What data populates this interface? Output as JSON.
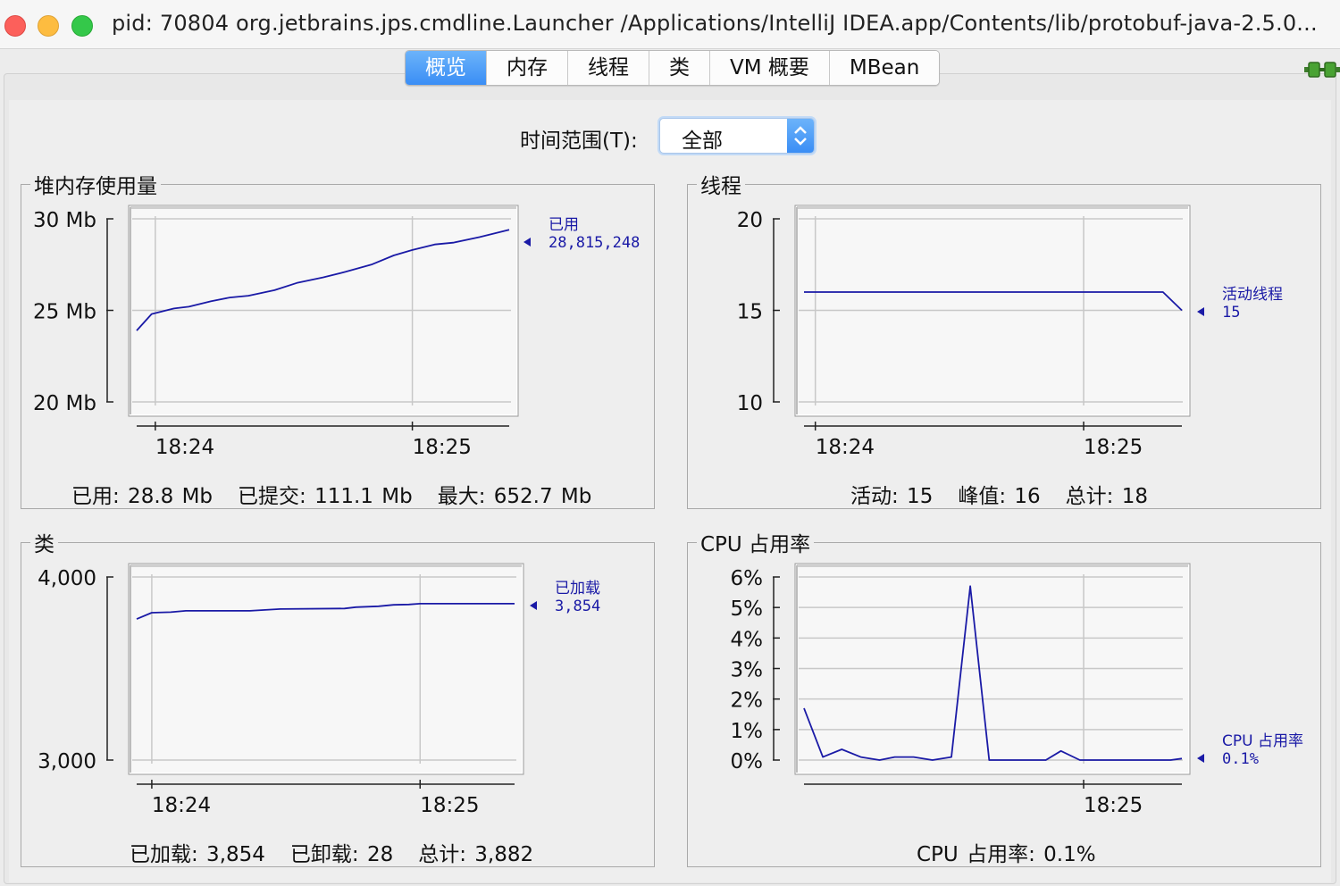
{
  "window": {
    "title": "pid: 70804 org.jetbrains.jps.cmdline.Launcher /Applications/IntelliJ IDEA.app/Contents/lib/protobuf-java-2.5.0..."
  },
  "tabs": [
    {
      "label": "概览",
      "active": true
    },
    {
      "label": "内存",
      "active": false
    },
    {
      "label": "线程",
      "active": false
    },
    {
      "label": "类",
      "active": false
    },
    {
      "label": "VM 概要",
      "active": false
    },
    {
      "label": "MBean",
      "active": false
    }
  ],
  "time_range": {
    "label": "时间范围(T):",
    "value": "全部"
  },
  "colors": {
    "series": "#1a1aa6",
    "grid": "#c8c8c8",
    "plot_bg": "#f7f7f7"
  },
  "heap": {
    "title": "堆内存使用量",
    "summary": [
      "已用: 28.8 Mb",
      "已提交: 111.1 Mb",
      "最大: 652.7 Mb"
    ]
  },
  "threads": {
    "title": "线程",
    "summary": [
      "活动: 15",
      "峰值: 16",
      "总计: 18"
    ]
  },
  "classes": {
    "title": "类",
    "summary": [
      "已加载: 3,854",
      "已卸载: 28",
      "总计: 3,882"
    ]
  },
  "cpu": {
    "title": "CPU 占用率",
    "summary": [
      "CPU 占用率: 0.1%"
    ]
  },
  "chart_data": [
    {
      "id": "heap",
      "type": "line",
      "ylim": [
        20,
        30
      ],
      "yticks": [
        {
          "v": 30,
          "label": "30 Mb"
        },
        {
          "v": 25,
          "label": "25 Mb"
        },
        {
          "v": 20,
          "label": "20 Mb"
        }
      ],
      "xlim": [
        0,
        1
      ],
      "xticks": [
        {
          "v": 0.05,
          "label": "18:24"
        },
        {
          "v": 0.74,
          "label": "18:25"
        }
      ],
      "series": [
        {
          "name": "已用",
          "value_label": "28,815,248",
          "x": [
            0,
            0.04,
            0.1,
            0.14,
            0.2,
            0.25,
            0.3,
            0.37,
            0.43,
            0.5,
            0.56,
            0.63,
            0.69,
            0.74,
            0.8,
            0.85,
            0.92,
            1.0
          ],
          "y": [
            23.9,
            24.8,
            25.1,
            25.2,
            25.5,
            25.7,
            25.8,
            26.1,
            26.5,
            26.8,
            27.1,
            27.5,
            28.0,
            28.3,
            28.6,
            28.7,
            29.0,
            29.4
          ]
        }
      ]
    },
    {
      "id": "threads",
      "type": "line",
      "ylim": [
        10,
        20
      ],
      "yticks": [
        {
          "v": 20,
          "label": "20"
        },
        {
          "v": 15,
          "label": "15"
        },
        {
          "v": 10,
          "label": "10"
        }
      ],
      "xlim": [
        0,
        1
      ],
      "xticks": [
        {
          "v": 0.03,
          "label": "18:24"
        },
        {
          "v": 0.74,
          "label": "18:25"
        }
      ],
      "series": [
        {
          "name": "活动线程",
          "value_label": "15",
          "x": [
            0,
            0.95,
            1.0
          ],
          "y": [
            16,
            16,
            15
          ]
        }
      ]
    },
    {
      "id": "classes",
      "type": "line",
      "ylim": [
        3000,
        4000
      ],
      "yticks": [
        {
          "v": 4000,
          "label": "4,000"
        },
        {
          "v": 3000,
          "label": "3,000"
        }
      ],
      "xlim": [
        0,
        1
      ],
      "xticks": [
        {
          "v": 0.04,
          "label": "18:24"
        },
        {
          "v": 0.75,
          "label": "18:25"
        }
      ],
      "series": [
        {
          "name": "已加载",
          "value_label": "3,854",
          "x": [
            0,
            0.04,
            0.09,
            0.13,
            0.3,
            0.38,
            0.55,
            0.58,
            0.64,
            0.68,
            0.72,
            0.75,
            1.0
          ],
          "y": [
            3770,
            3805,
            3808,
            3815,
            3815,
            3825,
            3828,
            3835,
            3840,
            3848,
            3850,
            3854,
            3854
          ]
        }
      ]
    },
    {
      "id": "cpu",
      "type": "line",
      "ylim": [
        0,
        6
      ],
      "yticks": [
        {
          "v": 6,
          "label": "6%"
        },
        {
          "v": 5,
          "label": "5%"
        },
        {
          "v": 4,
          "label": "4%"
        },
        {
          "v": 3,
          "label": "3%"
        },
        {
          "v": 2,
          "label": "2%"
        },
        {
          "v": 1,
          "label": "1%"
        },
        {
          "v": 0,
          "label": "0%"
        }
      ],
      "xlim": [
        0,
        1
      ],
      "xticks": [
        {
          "v": 0.74,
          "label": "18:25"
        }
      ],
      "series": [
        {
          "name": "CPU 占用率",
          "value_label": "0.1%",
          "x": [
            0,
            0.05,
            0.1,
            0.15,
            0.2,
            0.24,
            0.29,
            0.34,
            0.39,
            0.44,
            0.49,
            0.54,
            0.59,
            0.64,
            0.68,
            0.73,
            0.78,
            0.83,
            0.88,
            0.93,
            0.97,
            1.0
          ],
          "y": [
            1.7,
            0.1,
            0.35,
            0.1,
            0.0,
            0.1,
            0.1,
            0.0,
            0.1,
            5.7,
            0.0,
            0.0,
            0.0,
            0.0,
            0.3,
            0.0,
            0.0,
            0.0,
            0.0,
            0.0,
            0.0,
            0.05
          ]
        }
      ]
    }
  ]
}
